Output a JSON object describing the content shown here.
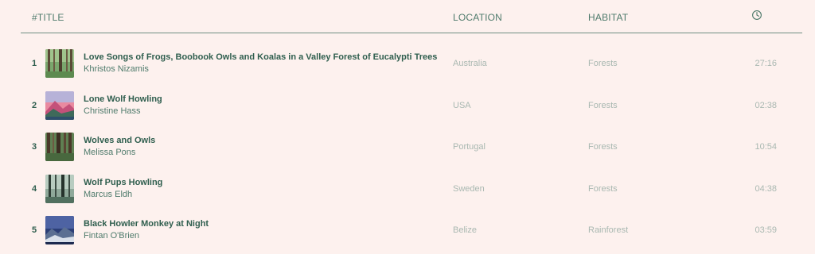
{
  "header": {
    "title_label": "#TITLE",
    "location_label": "LOCATION",
    "habitat_label": "HABITAT",
    "duration_icon": "clock-icon"
  },
  "tracks": [
    {
      "num": "1",
      "title": "Love Songs of Frogs, Boobook Owls and Koalas in a Valley Forest of Eucalypti Trees",
      "artist": "Khristos Nizamis",
      "location": "Australia",
      "habitat": "Forests",
      "duration": "27:16"
    },
    {
      "num": "2",
      "title": "Lone Wolf Howling",
      "artist": "Christine Hass",
      "location": "USA",
      "habitat": "Forests",
      "duration": "02:38"
    },
    {
      "num": "3",
      "title": "Wolves and Owls",
      "artist": "Melissa Pons",
      "location": "Portugal",
      "habitat": "Forests",
      "duration": "10:54"
    },
    {
      "num": "4",
      "title": "Wolf Pups Howling",
      "artist": "Marcus Eldh",
      "location": "Sweden",
      "habitat": "Forests",
      "duration": "04:38"
    },
    {
      "num": "5",
      "title": "Black Howler Monkey at Night",
      "artist": "Fintan O'Brien",
      "location": "Belize",
      "habitat": "Rainforest",
      "duration": "03:59"
    }
  ]
}
